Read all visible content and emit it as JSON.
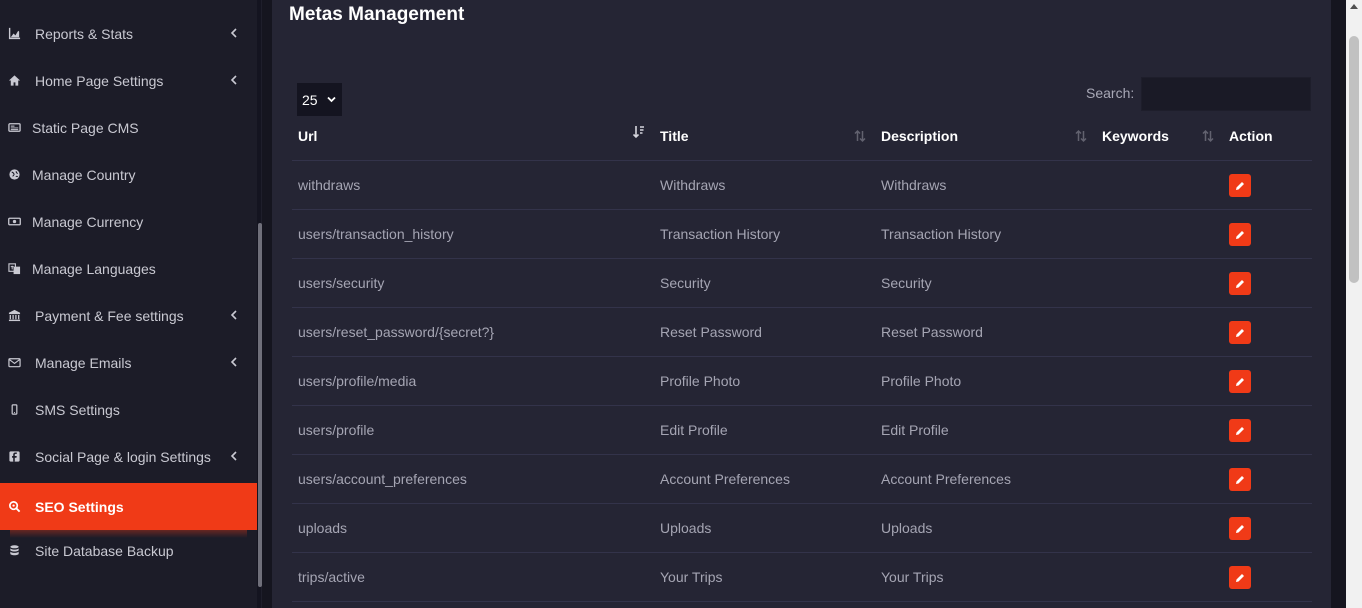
{
  "sidebar": {
    "items": [
      {
        "label": "Reports & Stats",
        "icon": "chart-area-icon",
        "submenu": true
      },
      {
        "label": "Home Page Settings",
        "icon": "home-icon",
        "submenu": true
      },
      {
        "label": "Static Page CMS",
        "icon": "newspaper-icon",
        "submenu": false
      },
      {
        "label": "Manage Country",
        "icon": "globe-icon",
        "submenu": false
      },
      {
        "label": "Manage Currency",
        "icon": "money-icon",
        "submenu": false
      },
      {
        "label": "Manage Languages",
        "icon": "language-icon",
        "submenu": false
      },
      {
        "label": "Payment & Fee settings",
        "icon": "bank-icon",
        "submenu": true
      },
      {
        "label": "Manage Emails",
        "icon": "envelope-icon",
        "submenu": true
      },
      {
        "label": "SMS Settings",
        "icon": "mobile-icon",
        "submenu": false
      },
      {
        "label": "Social Page & login Settings",
        "icon": "facebook-icon",
        "submenu": true
      },
      {
        "label": "SEO Settings",
        "icon": "search-icon",
        "submenu": false,
        "active": true
      },
      {
        "label": "Site Database Backup",
        "icon": "database-icon",
        "submenu": false
      }
    ]
  },
  "main": {
    "title": "Metas Management",
    "page_length": "25",
    "search_label": "Search:",
    "search_value": "",
    "columns": [
      "Url",
      "Title",
      "Description",
      "Keywords",
      "Action"
    ],
    "rows": [
      {
        "url": "withdraws",
        "title": "Withdraws",
        "description": "Withdraws",
        "keywords": ""
      },
      {
        "url": "users/transaction_history",
        "title": "Transaction History",
        "description": "Transaction History",
        "keywords": ""
      },
      {
        "url": "users/security",
        "title": "Security",
        "description": "Security",
        "keywords": ""
      },
      {
        "url": "users/reset_password/{secret?}",
        "title": "Reset Password",
        "description": "Reset Password",
        "keywords": ""
      },
      {
        "url": "users/profile/media",
        "title": "Profile Photo",
        "description": "Profile Photo",
        "keywords": ""
      },
      {
        "url": "users/profile",
        "title": "Edit Profile",
        "description": "Edit Profile",
        "keywords": ""
      },
      {
        "url": "users/account_preferences",
        "title": "Account Preferences",
        "description": "Account Preferences",
        "keywords": ""
      },
      {
        "url": "uploads",
        "title": "Uploads",
        "description": "Uploads",
        "keywords": ""
      },
      {
        "url": "trips/active",
        "title": "Your Trips",
        "description": "Your Trips",
        "keywords": ""
      }
    ]
  },
  "colors": {
    "accent": "#f03a17",
    "sidebar_bg": "#1c1c28",
    "card_bg": "#252534",
    "page_bg": "#15151f"
  }
}
